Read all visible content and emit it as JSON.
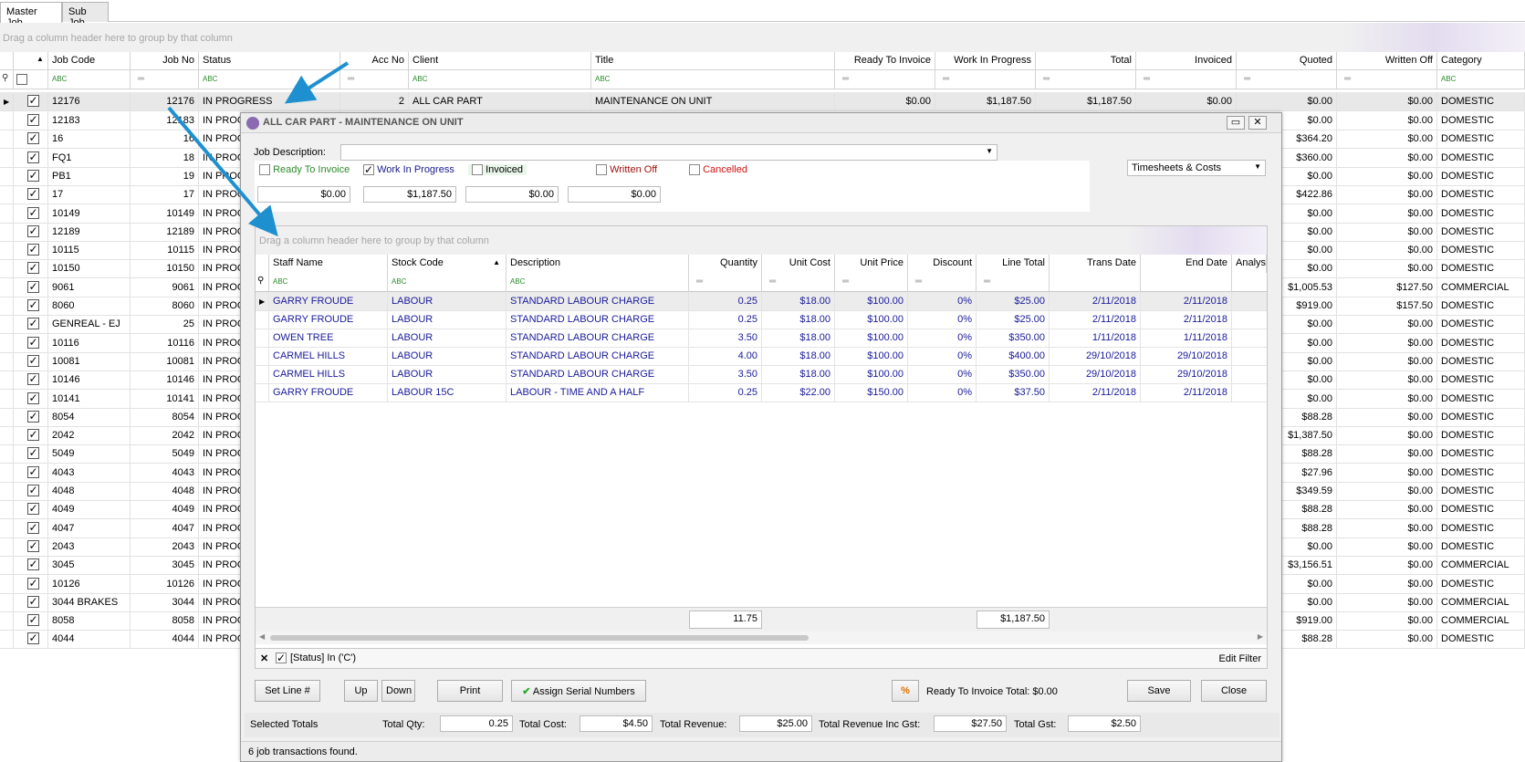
{
  "tabs": [
    {
      "label": "Master Job",
      "active": true
    },
    {
      "label": "Sub Job",
      "active": false
    }
  ],
  "group_hint": "Drag a column header here to group by that column",
  "master": {
    "columns": [
      "Job Code",
      "Job No",
      "Status",
      "Acc No",
      "Client",
      "Title",
      "Ready To Invoice",
      "Work In Progress",
      "Total",
      "Invoiced",
      "Quoted",
      "Written Off",
      "Category"
    ],
    "first_row": {
      "job_code": "12176",
      "job_no": "12176",
      "status": "IN PROGRESS",
      "acc_no": "2",
      "client": "ALL CAR PART",
      "title": "MAINTENANCE ON UNIT",
      "ready": "$0.00",
      "wip": "$1,187.50",
      "total": "$1,187.50",
      "invoiced": "$0.00",
      "quoted": "$0.00",
      "written_off": "$0.00",
      "category": "DOMESTIC"
    },
    "rows": [
      {
        "job_code": "12183",
        "job_no": "12183",
        "status": "IN PROG",
        "quoted": "$0.00",
        "written_off": "$0.00",
        "category": "DOMESTIC"
      },
      {
        "job_code": "16",
        "job_no": "16",
        "status": "IN PROG",
        "quoted": "$364.20",
        "written_off": "$0.00",
        "category": "DOMESTIC"
      },
      {
        "job_code": "FQ1",
        "job_no": "18",
        "status": "IN PROG",
        "quoted": "$360.00",
        "written_off": "$0.00",
        "category": "DOMESTIC"
      },
      {
        "job_code": "PB1",
        "job_no": "19",
        "status": "IN PROG",
        "quoted": "$0.00",
        "written_off": "$0.00",
        "category": "DOMESTIC"
      },
      {
        "job_code": "17",
        "job_no": "17",
        "status": "IN PROG",
        "quoted": "$422.86",
        "written_off": "$0.00",
        "category": "DOMESTIC"
      },
      {
        "job_code": "10149",
        "job_no": "10149",
        "status": "IN PROG",
        "quoted": "$0.00",
        "written_off": "$0.00",
        "category": "DOMESTIC"
      },
      {
        "job_code": "12189",
        "job_no": "12189",
        "status": "IN PROG",
        "quoted": "$0.00",
        "written_off": "$0.00",
        "category": "DOMESTIC"
      },
      {
        "job_code": "10115",
        "job_no": "10115",
        "status": "IN PROG",
        "quoted": "$0.00",
        "written_off": "$0.00",
        "category": "DOMESTIC"
      },
      {
        "job_code": "10150",
        "job_no": "10150",
        "status": "IN PROG",
        "quoted": "$0.00",
        "written_off": "$0.00",
        "category": "DOMESTIC"
      },
      {
        "job_code": "9061",
        "job_no": "9061",
        "status": "IN PROG",
        "quoted": "$1,005.53",
        "written_off": "$127.50",
        "category": "COMMERCIAL"
      },
      {
        "job_code": "8060",
        "job_no": "8060",
        "status": "IN PROG",
        "quoted": "$919.00",
        "written_off": "$157.50",
        "category": "DOMESTIC"
      },
      {
        "job_code": "GENREAL - EJ",
        "job_no": "25",
        "status": "IN PROG",
        "quoted": "$0.00",
        "written_off": "$0.00",
        "category": "DOMESTIC"
      },
      {
        "job_code": "10116",
        "job_no": "10116",
        "status": "IN PROG",
        "quoted": "$0.00",
        "written_off": "$0.00",
        "category": "DOMESTIC"
      },
      {
        "job_code": "10081",
        "job_no": "10081",
        "status": "IN PROG",
        "quoted": "$0.00",
        "written_off": "$0.00",
        "category": "DOMESTIC"
      },
      {
        "job_code": "10146",
        "job_no": "10146",
        "status": "IN PROG",
        "quoted": "$0.00",
        "written_off": "$0.00",
        "category": "DOMESTIC"
      },
      {
        "job_code": "10141",
        "job_no": "10141",
        "status": "IN PROG",
        "quoted": "$0.00",
        "written_off": "$0.00",
        "category": "DOMESTIC"
      },
      {
        "job_code": "8054",
        "job_no": "8054",
        "status": "IN PROG",
        "quoted": "$88.28",
        "written_off": "$0.00",
        "category": "DOMESTIC"
      },
      {
        "job_code": "2042",
        "job_no": "2042",
        "status": "IN PROG",
        "quoted": "$1,387.50",
        "written_off": "$0.00",
        "category": "DOMESTIC"
      },
      {
        "job_code": "5049",
        "job_no": "5049",
        "status": "IN PROG",
        "quoted": "$88.28",
        "written_off": "$0.00",
        "category": "DOMESTIC"
      },
      {
        "job_code": "4043",
        "job_no": "4043",
        "status": "IN PROG",
        "quoted": "$27.96",
        "written_off": "$0.00",
        "category": "DOMESTIC"
      },
      {
        "job_code": "4048",
        "job_no": "4048",
        "status": "IN PROG",
        "quoted": "$349.59",
        "written_off": "$0.00",
        "category": "DOMESTIC"
      },
      {
        "job_code": "4049",
        "job_no": "4049",
        "status": "IN PROG",
        "quoted": "$88.28",
        "written_off": "$0.00",
        "category": "DOMESTIC"
      },
      {
        "job_code": "4047",
        "job_no": "4047",
        "status": "IN PROG",
        "quoted": "$88.28",
        "written_off": "$0.00",
        "category": "DOMESTIC"
      },
      {
        "job_code": "2043",
        "job_no": "2043",
        "status": "IN PROG",
        "quoted": "$0.00",
        "written_off": "$0.00",
        "category": "DOMESTIC"
      },
      {
        "job_code": "3045",
        "job_no": "3045",
        "status": "IN PROG",
        "quoted": "$3,156.51",
        "written_off": "$0.00",
        "category": "COMMERCIAL"
      },
      {
        "job_code": "10126",
        "job_no": "10126",
        "status": "IN PROG",
        "quoted": "$0.00",
        "written_off": "$0.00",
        "category": "DOMESTIC"
      },
      {
        "job_code": "3044 BRAKES",
        "job_no": "3044",
        "status": "IN PROG",
        "quoted": "$0.00",
        "written_off": "$0.00",
        "category": "COMMERCIAL"
      },
      {
        "job_code": "8058",
        "job_no": "8058",
        "status": "IN PROG",
        "quoted": "$919.00",
        "written_off": "$0.00",
        "category": "COMMERCIAL"
      },
      {
        "job_code": "4044",
        "job_no": "4044",
        "status": "IN PROG",
        "quoted": "$88.28",
        "written_off": "$0.00",
        "category": "DOMESTIC"
      }
    ]
  },
  "dialog": {
    "title": "ALL CAR PART - MAINTENANCE ON UNIT",
    "job_description_label": "Job Description:",
    "job_description_value": "",
    "view_select": "Timesheets & Costs",
    "flags": [
      {
        "label": "Ready To Invoice",
        "checked": false,
        "amount": "$0.00",
        "color": "#2e8b2e"
      },
      {
        "label": "Work In Progress",
        "checked": true,
        "amount": "$1,187.50",
        "color": "#1a1a8a"
      },
      {
        "label": "Invoiced",
        "checked": false,
        "amount": "$0.00",
        "color": "#000000"
      },
      {
        "label": "Written Off",
        "checked": false,
        "amount": "$0.00",
        "color": "#a01010"
      },
      {
        "label": "Cancelled",
        "checked": false,
        "color": "#d01010"
      }
    ],
    "grid": {
      "group_hint": "Drag a column header here to group by that column",
      "columns": [
        "Staff Name",
        "Stock Code",
        "Description",
        "Quantity",
        "Unit Cost",
        "Unit Price",
        "Discount",
        "Line Total",
        "Trans Date",
        "End Date",
        "Analysis"
      ],
      "rows": [
        [
          "GARRY FROUDE",
          "LABOUR",
          "STANDARD LABOUR CHARGE",
          "0.25",
          "$18.00",
          "$100.00",
          "0%",
          "$25.00",
          "2/11/2018",
          "2/11/2018"
        ],
        [
          "GARRY FROUDE",
          "LABOUR",
          "STANDARD LABOUR CHARGE",
          "0.25",
          "$18.00",
          "$100.00",
          "0%",
          "$25.00",
          "2/11/2018",
          "2/11/2018"
        ],
        [
          "OWEN TREE",
          "LABOUR",
          "STANDARD LABOUR CHARGE",
          "3.50",
          "$18.00",
          "$100.00",
          "0%",
          "$350.00",
          "1/11/2018",
          "1/11/2018"
        ],
        [
          "CARMEL HILLS",
          "LABOUR",
          "STANDARD LABOUR CHARGE",
          "4.00",
          "$18.00",
          "$100.00",
          "0%",
          "$400.00",
          "29/10/2018",
          "29/10/2018"
        ],
        [
          "CARMEL HILLS",
          "LABOUR",
          "STANDARD LABOUR CHARGE",
          "3.50",
          "$18.00",
          "$100.00",
          "0%",
          "$350.00",
          "29/10/2018",
          "29/10/2018"
        ],
        [
          "GARRY FROUDE",
          "LABOUR 15C",
          "LABOUR - TIME AND A HALF",
          "0.25",
          "$22.00",
          "$150.00",
          "0%",
          "$37.50",
          "2/11/2018",
          "2/11/2018"
        ]
      ],
      "sum_quantity": "11.75",
      "sum_line_total": "$1,187.50",
      "filter_text": "[Status] In ('C')",
      "edit_filter": "Edit Filter"
    },
    "buttons": {
      "set_line": "Set Line #",
      "up": "Up",
      "down": "Down",
      "print": "Print",
      "assign_serial": "Assign Serial Numbers",
      "percent": "%",
      "save": "Save",
      "close": "Close"
    },
    "ready_total": "Ready To Invoice Total: $0.00",
    "totals": {
      "label": "Selected Totals",
      "qty_label": "Total Qty:",
      "qty": "0.25",
      "cost_label": "Total Cost:",
      "cost": "$4.50",
      "rev_label": "Total Revenue:",
      "rev": "$25.00",
      "revgst_label": "Total Revenue Inc Gst:",
      "revgst": "$27.50",
      "gst_label": "Total Gst:",
      "gst": "$2.50"
    },
    "status": "6 job transactions found."
  },
  "colors": {
    "accent_arrow": "#1e90d0",
    "link_blue": "#1a1a9a"
  }
}
